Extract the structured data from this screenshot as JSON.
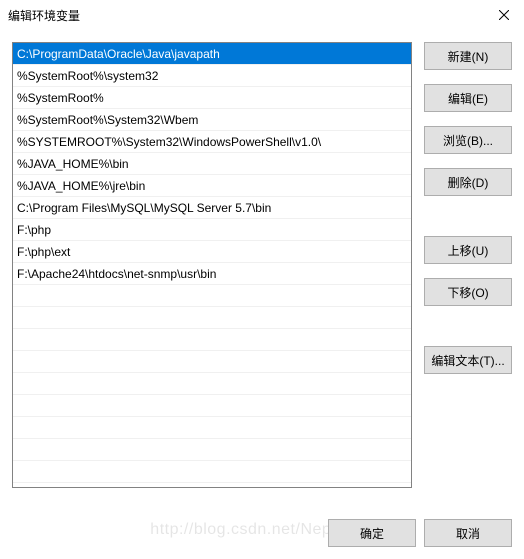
{
  "titlebar": {
    "title": "编辑环境变量"
  },
  "paths": [
    "C:\\ProgramData\\Oracle\\Java\\javapath",
    "%SystemRoot%\\system32",
    "%SystemRoot%",
    "%SystemRoot%\\System32\\Wbem",
    "%SYSTEMROOT%\\System32\\WindowsPowerShell\\v1.0\\",
    "%JAVA_HOME%\\bin",
    "%JAVA_HOME%\\jre\\bin",
    "C:\\Program Files\\MySQL\\MySQL Server 5.7\\bin",
    "F:\\php",
    "F:\\php\\ext",
    "F:\\Apache24\\htdocs\\net-snmp\\usr\\bin"
  ],
  "selected_index": 0,
  "buttons": {
    "new": "新建(N)",
    "edit": "编辑(E)",
    "browse": "浏览(B)...",
    "delete": "删除(D)",
    "moveup": "上移(U)",
    "movedown": "下移(O)",
    "edittext": "编辑文本(T)...",
    "ok": "确定",
    "cancel": "取消"
  },
  "watermark": "http://blog.csdn.net/NepalTrip"
}
